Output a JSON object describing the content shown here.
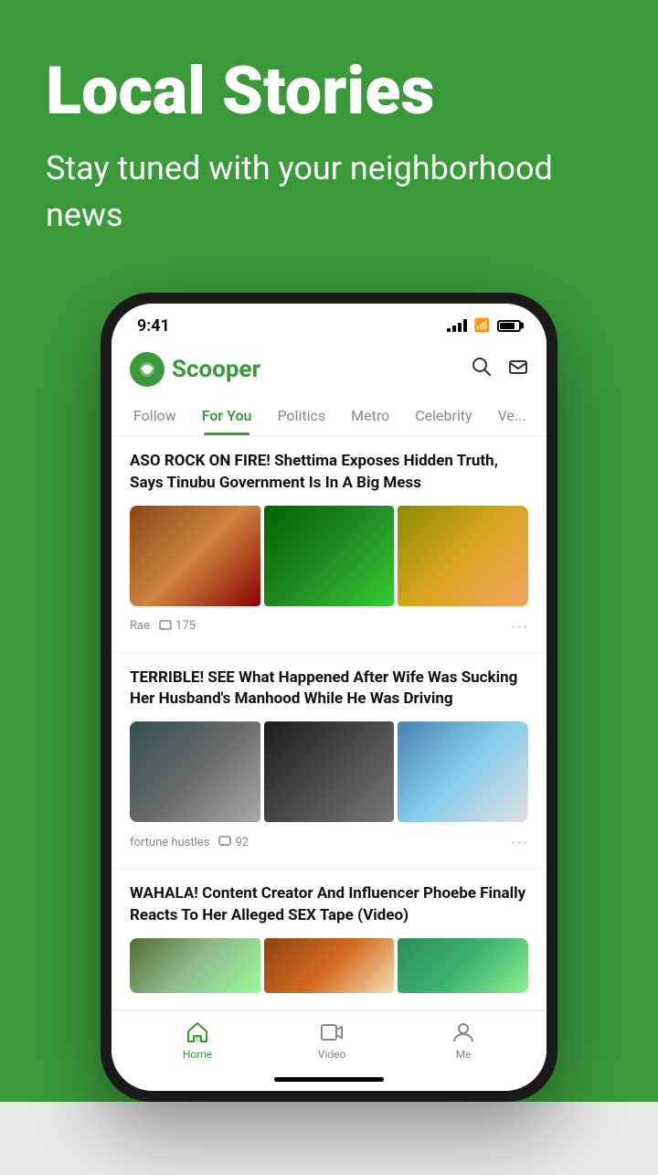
{
  "hero": {
    "title": "Local Stories",
    "subtitle": "Stay tuned with your neighborhood news"
  },
  "app": {
    "name": "Scooper"
  },
  "statusBar": {
    "time": "9:41"
  },
  "navTabs": {
    "tabs": [
      {
        "label": "Follow",
        "active": false
      },
      {
        "label": "For You",
        "active": true
      },
      {
        "label": "Politics",
        "active": false
      },
      {
        "label": "Metro",
        "active": false
      },
      {
        "label": "Celebrity",
        "active": false
      },
      {
        "label": "Ve...",
        "active": false
      }
    ]
  },
  "articles": [
    {
      "title": "ASO ROCK ON FIRE! Shettima Exposes Hidden Truth, Says Tinubu Government Is In A Big Mess",
      "author": "Rae",
      "comments": "175",
      "images": [
        "img-1",
        "img-2",
        "img-3"
      ]
    },
    {
      "title": "TERRIBLE! SEE What Happened After Wife Was Sucking Her Husband's Manhood While He Was Driving",
      "author": "fortune hustles",
      "comments": "92",
      "images": [
        "img-4",
        "img-5",
        "img-6"
      ]
    },
    {
      "title": "WAHALA! Content Creator And Influencer Phoebe Finally Reacts To Her Alleged SEX Tape (Video)",
      "author": "",
      "comments": "",
      "images": [
        "img-7",
        "img-8",
        "img-9"
      ]
    }
  ],
  "bottomNav": {
    "items": [
      {
        "label": "Home",
        "active": true,
        "icon": "home"
      },
      {
        "label": "Video",
        "active": false,
        "icon": "video"
      },
      {
        "label": "Me",
        "active": false,
        "icon": "person"
      }
    ]
  }
}
